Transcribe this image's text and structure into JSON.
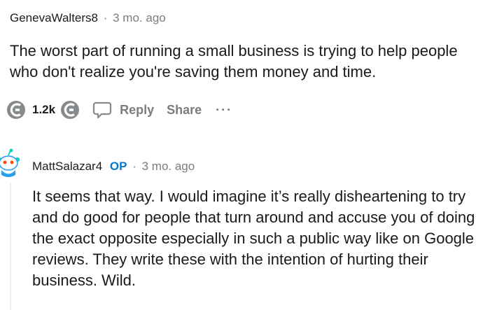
{
  "comment1": {
    "username": "GenevaWalters8",
    "separator": "·",
    "timestamp": "3 mo. ago",
    "body": "The worst part of running a small business is trying to help people who don't realize you're saving them money and time.",
    "actions": {
      "vote_count": "1.2k",
      "reply_label": "Reply",
      "share_label": "Share",
      "more_label": "···"
    }
  },
  "comment2": {
    "username": "MattSalazar4",
    "op_badge": "OP",
    "separator": "·",
    "timestamp": "3 mo. ago",
    "body": "It seems that way. I would imagine it’s really disheartening to try and do good for people that turn around and accuse you of doing the exact opposite especially in such a public way like on Google reviews. They write these with the intention of hurting their business. Wild."
  },
  "icons": {
    "upvote": "upvote-icon",
    "downvote": "downvote-icon",
    "reply": "speech-bubble-icon",
    "avatar": "snoo-avatar-icon"
  },
  "colors": {
    "op_blue": "#0079d3",
    "meta_gray": "#7c7c7c",
    "icon_gray": "#878a8c"
  }
}
